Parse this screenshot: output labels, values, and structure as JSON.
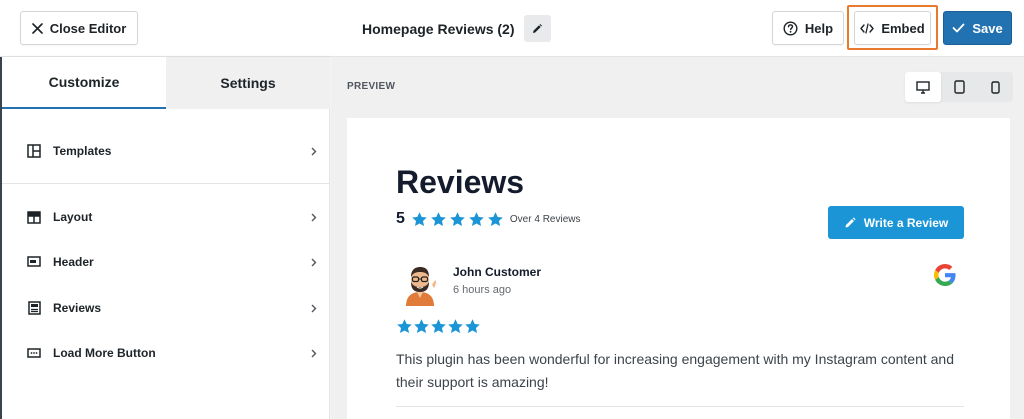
{
  "topbar": {
    "close_label": "Close Editor",
    "title": "Homepage Reviews (2)",
    "help_label": "Help",
    "embed_label": "Embed",
    "save_label": "Save",
    "accent_color": "#2271b1",
    "highlight_color": "#e8792f"
  },
  "sidebar": {
    "tabs": [
      {
        "label": "Customize",
        "active": true
      },
      {
        "label": "Settings",
        "active": false
      }
    ],
    "items": [
      {
        "label": "Templates",
        "icon": "templates-icon"
      },
      {
        "label": "Layout",
        "icon": "layout-icon"
      },
      {
        "label": "Header",
        "icon": "header-icon"
      },
      {
        "label": "Reviews",
        "icon": "reviews-icon"
      },
      {
        "label": "Load More Button",
        "icon": "load-more-icon"
      }
    ]
  },
  "preview": {
    "label": "PREVIEW",
    "devices": [
      "desktop-icon",
      "tablet-icon",
      "mobile-icon"
    ],
    "active_device": "desktop",
    "heading": "Reviews",
    "rating": "5",
    "star_count": 5,
    "review_count": "Over 4 Reviews",
    "write_review_label": "Write a Review",
    "star_color": "#1b95d6",
    "review": {
      "author": "John Customer",
      "time": "6 hours ago",
      "stars": 5,
      "source_icon": "google-icon",
      "text": "This plugin has been wonderful for increasing engagement with my Instagram content and their support is amazing!"
    }
  }
}
